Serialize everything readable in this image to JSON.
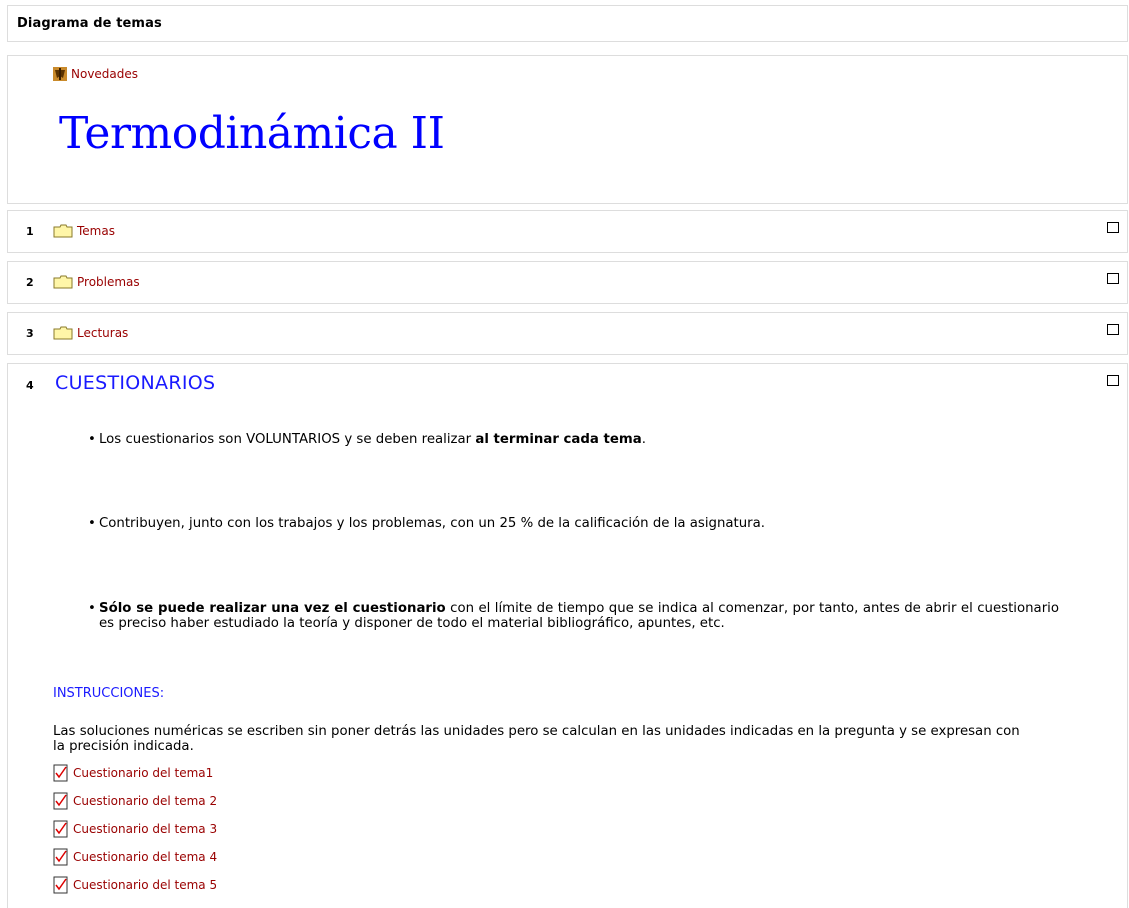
{
  "header": {
    "title": "Diagrama de temas"
  },
  "intro": {
    "news_label": "Novedades",
    "course_title": "Termodinámica II"
  },
  "topics": [
    {
      "number": "1",
      "label": "Temas"
    },
    {
      "number": "2",
      "label": "Problemas"
    },
    {
      "number": "3",
      "label": "Lecturas"
    }
  ],
  "quizzes_section": {
    "number": "4",
    "title": "CUESTIONARIOS",
    "rules": [
      {
        "pre": "Los cuestionarios son VOLUNTARIOS y se deben realizar ",
        "bold": "al terminar cada tema",
        "post": "."
      },
      {
        "pre": "Contribuyen, junto con los trabajos y los problemas, con un 25 % de la calificación de la asignatura.",
        "bold": "",
        "post": ""
      },
      {
        "pre": "",
        "bold": "Sólo se puede realizar una vez el cuestionario",
        "post": " con el límite de tiempo que se indica al comenzar, por tanto, antes de abrir el cuestionario es preciso haber estudiado la teoría y disponer de todo el material bibliográfico, apuntes, etc."
      }
    ],
    "instructions_label": "INSTRUCCIONES:",
    "instructions_text": "Las soluciones numéricas se escriben sin poner detrás las unidades pero se calculan en las unidades indicadas en la pregunta y se expresan con la precisión indicada.",
    "quizzes": [
      "Cuestionario del tema1",
      "Cuestionario del tema 2",
      "Cuestionario del tema 3",
      "Cuestionario del tema 4",
      "Cuestionario del tema 5"
    ]
  },
  "colors": {
    "link": "#990000",
    "accent_blue": "#0000ff",
    "border": "#dddddd"
  },
  "icons": {
    "news": "news-forum-icon",
    "folder": "folder-icon",
    "quiz": "quiz-icon",
    "checkbox": "highlight-checkbox"
  }
}
